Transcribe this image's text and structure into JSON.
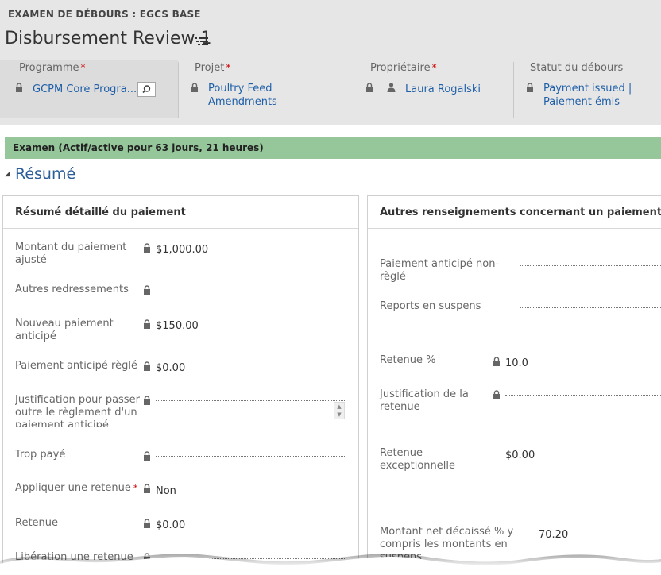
{
  "header": {
    "entity_type": "EXAMEN DE DÉBOURS : EGCS BASE",
    "record_title": "Disbursement Review 1",
    "fields": [
      {
        "label": "Programme",
        "required": "*",
        "value": "GCPM Core Progra..."
      },
      {
        "label": "Projet",
        "required": "*",
        "value_line1": "Poultry Feed",
        "value_line2": "Amendments"
      },
      {
        "label": "Propriétaire",
        "required": "*",
        "value": "Laura Rogalski"
      },
      {
        "label": "Statut du débours",
        "value_line1": "Payment issued |",
        "value_line2": "Paiement émis"
      }
    ]
  },
  "status_bar": {
    "text": "Examen (Actif/active pour 63 jours, 21 heures)"
  },
  "section": {
    "toggle": "◢",
    "title": "Résumé"
  },
  "left_panel": {
    "title": "Résumé détaillé du paiement",
    "rows": [
      {
        "label1": "Montant du paiement",
        "label2": "ajusté",
        "value": "$1,000.00"
      },
      {
        "label1": "Autres redressements"
      },
      {
        "label1": "Nouveau paiement",
        "label2": "anticipé",
        "value": "$150.00"
      },
      {
        "label1": "Paiement anticipé règlé",
        "value": "$0.00"
      },
      {
        "label1": "Justification pour passer",
        "label2": "outre le règlement d'un",
        "label3": "paiement anticipé"
      },
      {
        "label1": "Trop payé"
      },
      {
        "label1": "Appliquer une retenue",
        "required": "*",
        "value": "Non"
      },
      {
        "label1": "Retenue",
        "value": "$0.00"
      },
      {
        "label1": "Libération une retenue"
      }
    ]
  },
  "right_panel": {
    "title": "Autres renseignements concernant un paiement",
    "rows": [
      {
        "label1": "Paiement anticipé non-",
        "label2": "règlé"
      },
      {
        "label1": "Reports en suspens"
      },
      {
        "label1": "Retenue %",
        "value": "10.0"
      },
      {
        "label1": "Justification de la",
        "label2": "retenue"
      },
      {
        "label1": "Retenue",
        "label2": "exceptionnelle",
        "value": "$0.00"
      },
      {
        "label1": "Montant net décaissé % y",
        "label2": "compris les montants en",
        "label3": "suspens",
        "value": "70.20"
      }
    ]
  },
  "colors": {
    "status_bar": "#96c79a",
    "link": "#1f5fa8",
    "header_bg": "#e6e6e6",
    "required": "#cc0000"
  },
  "icons": [
    "lock-icon",
    "search-icon",
    "user-icon",
    "menu-icon",
    "scroll-arrows-icon"
  ]
}
